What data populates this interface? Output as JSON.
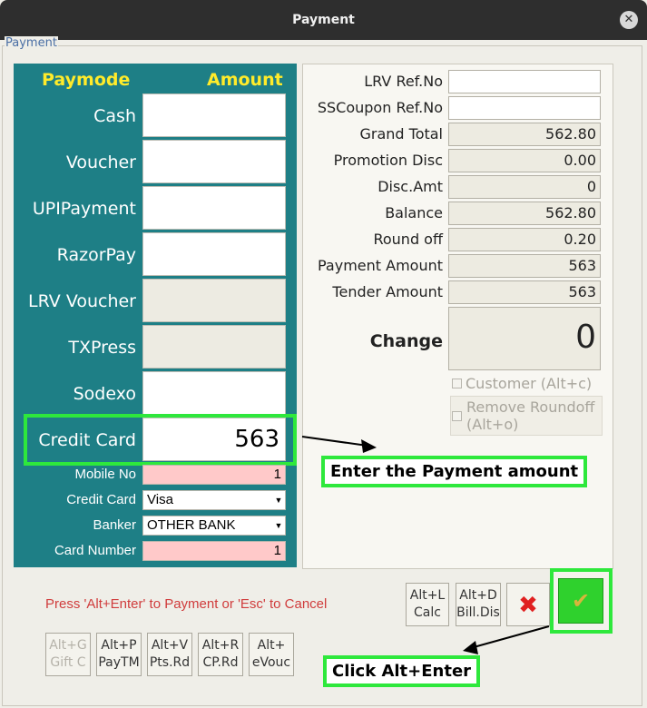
{
  "window": {
    "title": "Payment",
    "close": "✕",
    "group_label": "Payment"
  },
  "paymodes": {
    "header_mode": "Paymode",
    "header_amount": "Amount",
    "items": [
      {
        "label": "Cash",
        "value": ""
      },
      {
        "label": "Voucher",
        "value": ""
      },
      {
        "label": "UPIPayment",
        "value": ""
      },
      {
        "label": "RazorPay",
        "value": ""
      },
      {
        "label": "LRV Voucher",
        "value": ""
      },
      {
        "label": "TXPress",
        "value": ""
      },
      {
        "label": "Sodexo",
        "value": ""
      },
      {
        "label": "Credit Card",
        "value": "563"
      }
    ]
  },
  "card": {
    "mobile_label": "Mobile No",
    "mobile_value": "1",
    "credit_card_label": "Credit Card",
    "credit_card_value": "Visa",
    "banker_label": "Banker",
    "banker_value": "OTHER BANK",
    "card_number_label": "Card Number",
    "card_number_value": "1"
  },
  "summary": {
    "rows": [
      {
        "label": "LRV Ref.No",
        "value": ""
      },
      {
        "label": "SSCoupon Ref.No",
        "value": ""
      },
      {
        "label": "Grand Total",
        "value": "562.80"
      },
      {
        "label": "Promotion Disc",
        "value": "0.00"
      },
      {
        "label": "Disc.Amt",
        "value": "0"
      },
      {
        "label": "Balance",
        "value": "562.80"
      },
      {
        "label": "Round off",
        "value": "0.20"
      },
      {
        "label": "Payment Amount",
        "value": "563"
      },
      {
        "label": "Tender Amount",
        "value": "563"
      }
    ],
    "change_label": "Change",
    "change_value": "0",
    "customer_label": "Customer (Alt+c)",
    "remove_roundoff_label_1": "Remove Roundoff",
    "remove_roundoff_label_2": "(Alt+o)"
  },
  "footer": {
    "hint": "Press 'Alt+Enter' to Payment or 'Esc' to Cancel",
    "calc_btn": {
      "line1": "Alt+L",
      "line2": "Calc"
    },
    "billdis_btn": {
      "line1": "Alt+D",
      "line2": "Bill.Dis"
    },
    "cancel_symbol": "✖",
    "ok_symbol": "✔",
    "giftc_btn": {
      "line1": "Alt+G",
      "line2": "Gift C"
    },
    "paytm_btn": {
      "line1": "Alt+P",
      "line2": "PayTM"
    },
    "ptsrd_btn": {
      "line1": "Alt+V",
      "line2": "Pts.Rd"
    },
    "cprd_btn": {
      "line1": "Alt+R",
      "line2": "CP.Rd"
    },
    "evouc_btn": {
      "line1": "Alt+",
      "line2": "eVouc"
    }
  },
  "annotations": {
    "enter_amount": "Enter the Payment amount",
    "click_alt_enter": "Click Alt+Enter"
  },
  "colors": {
    "panel": "#1e7f86",
    "header_yellow": "#ffeb2a",
    "highlight_green": "#2ee83c",
    "hint_red": "#d03c3c"
  }
}
